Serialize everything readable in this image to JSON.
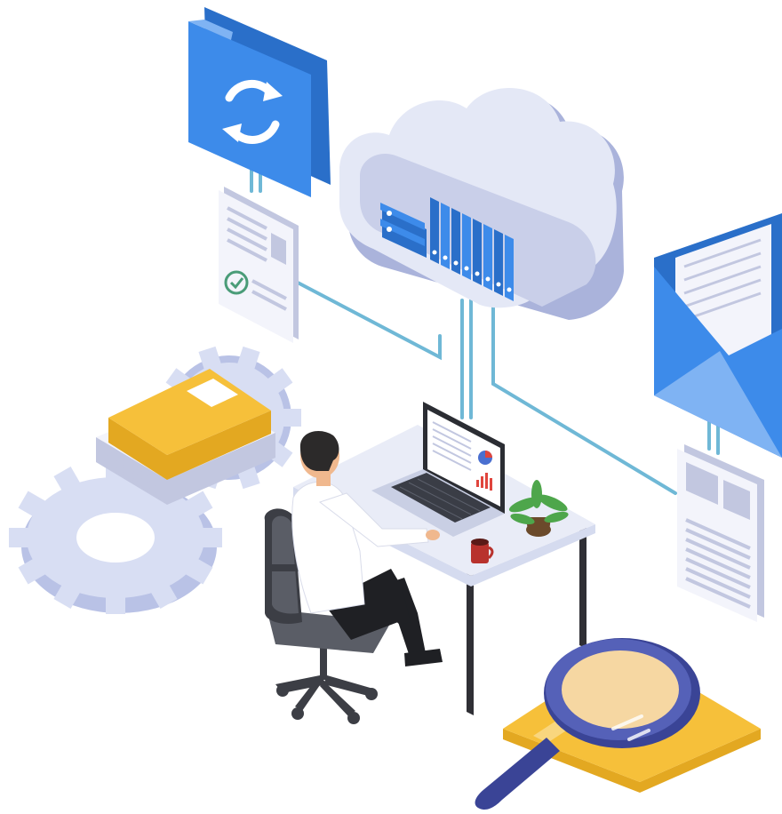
{
  "palette": {
    "blue": "#3d8bea",
    "blue_dark": "#2a6fc9",
    "blue_light": "#7fb3f3",
    "cloud": "#e4e8f6",
    "cloud_shade": "#c9cfe9",
    "cloud_dark": "#aab3db",
    "line": "#6fb8d6",
    "paper": "#f3f4fb",
    "paper_line": "#c2c7e0",
    "yellow": "#f6c03a",
    "yellow_dark": "#e3a821",
    "gear": "#d8def3",
    "gear_shade": "#b9c2e6",
    "desk": "#e9ecf7",
    "desk_leg": "#2f2f35",
    "chair": "#5a5d66",
    "chair_dark": "#3c3e45",
    "skin": "#f0b88e",
    "hair": "#2c2a2a",
    "shirt": "#ffffff",
    "pants": "#1f2024",
    "mug": "#b8322d",
    "plant": "#4ea64b",
    "pot": "#6b4a2b",
    "lens": "#f6d7a2",
    "rim": "#5561b8",
    "handle": "#3a4496",
    "check": "#4a9c78"
  },
  "icons": {
    "folder": "sync-folder-icon",
    "cloud": "cloud-storage-icon",
    "envelope": "mail-envelope-icon",
    "document_check": "approved-document-icon",
    "document": "report-document-icon",
    "gears": "settings-gears-icon",
    "books": "book-stack-icon",
    "magnifier": "magnifying-glass-icon",
    "laptop": "laptop-icon"
  }
}
